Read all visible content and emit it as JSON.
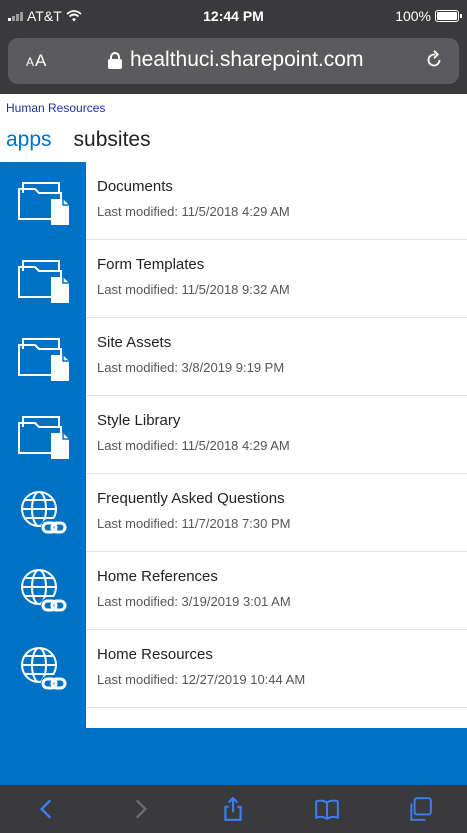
{
  "status": {
    "carrier": "AT&T",
    "time": "12:44 PM",
    "battery": "100%"
  },
  "browser": {
    "text_size": "AA",
    "url": "healthuci.sharepoint.com"
  },
  "page": {
    "breadcrumb": "Human Resources",
    "tabs": {
      "apps": "apps",
      "subsites": "subsites"
    }
  },
  "items": [
    {
      "name": "Documents",
      "modified": "Last modified: 11/5/2018 4:29 AM",
      "icon": "folder-icon"
    },
    {
      "name": "Form Templates",
      "modified": "Last modified: 11/5/2018 9:32 AM",
      "icon": "folder-icon"
    },
    {
      "name": "Site Assets",
      "modified": "Last modified: 3/8/2019 9:19 PM",
      "icon": "folder-icon"
    },
    {
      "name": "Style Library",
      "modified": "Last modified: 11/5/2018 4:29 AM",
      "icon": "folder-icon"
    },
    {
      "name": "Frequently Asked Questions",
      "modified": "Last modified: 11/7/2018 7:30 PM",
      "icon": "globe-link-icon"
    },
    {
      "name": "Home References",
      "modified": "Last modified: 3/19/2019 3:01 AM",
      "icon": "globe-link-icon"
    },
    {
      "name": "Home Resources",
      "modified": "Last modified: 12/27/2019 10:44 AM",
      "icon": "globe-link-icon"
    }
  ],
  "colors": {
    "accent": "#0072c6",
    "chrome": "#3a3a3c",
    "link": "#1a2fa5"
  }
}
